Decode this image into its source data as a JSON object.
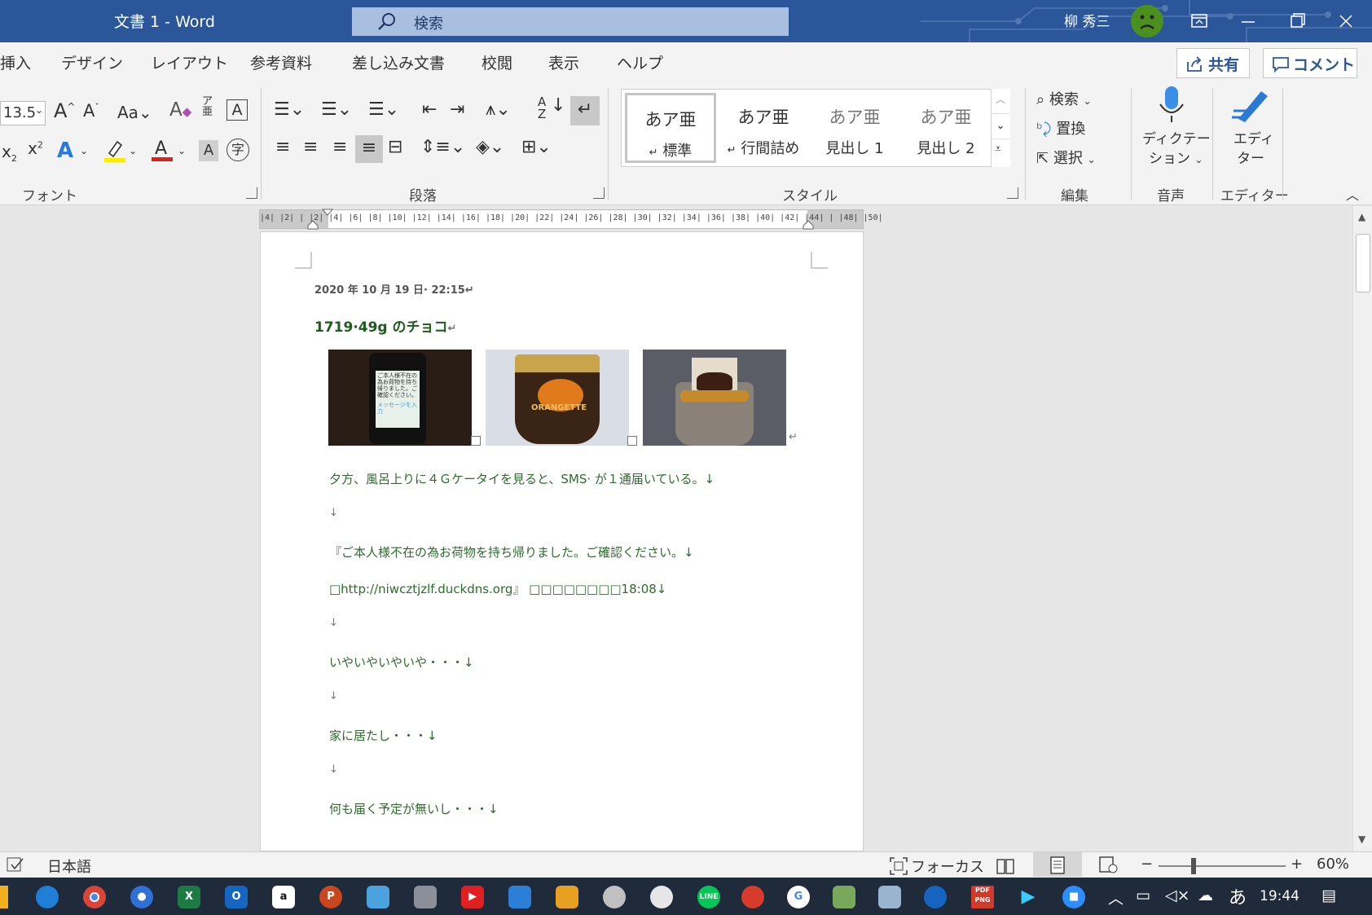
{
  "window": {
    "title": "文書 1  -  Word",
    "search_placeholder": "検索",
    "user": "柳 秀三"
  },
  "tabs": [
    "挿入",
    "デザイン",
    "レイアウト",
    "参考資料",
    "差し込み文書",
    "校閲",
    "表示",
    "ヘルプ"
  ],
  "share_label": "共有",
  "comment_label": "コメント",
  "ribbon": {
    "font_size": "13.5",
    "font_group": "フォント",
    "paragraph_group": "段落",
    "styles_group": "スタイル",
    "editing_group": "編集",
    "voice_group": "音声",
    "editor_group": "エディター",
    "styles": [
      {
        "sample": "あア亜",
        "name": "標準",
        "mark": "↵"
      },
      {
        "sample": "あア亜",
        "name": "行間詰め",
        "mark": "↵"
      },
      {
        "sample": "あア亜",
        "name": "見出し 1",
        "mark": ""
      },
      {
        "sample": "あア亜",
        "name": "見出し 2",
        "mark": ""
      }
    ],
    "find_label": "検索",
    "replace_label": "置換",
    "select_label": "選択",
    "dictate_label_1": "ディクテー",
    "dictate_label_2": "ション",
    "editor_label_1": "エディ",
    "editor_label_2": "ター"
  },
  "ruler_ticks": "|4|  |2|  |     |2|   |4|   |6|   |8|   |10|  |12|  |14|  |16|  |18|  |20|  |22|  |24|  |26|  |28|  |30|  |32|  |34|  |36|  |38|  |40|  |42|  |44|  |      |48|  |50|",
  "document": {
    "date": "2020 年 10 月 19 日· 22:15↵",
    "title": "1719·49g のチョコ",
    "title_mark": "↵",
    "lines": [
      "夕方、風呂上りに４Ｇケータイを見ると、SMS· が１通届いている。↓",
      "↓",
      "『ご本人様不在の為お荷物を持ち帰りました。ご確認ください。↓",
      "□http://niwcztjzlf.duckdns.org』 □□□□□□□□18:08↓",
      "↓",
      "いやいやいやいや・・・↓",
      "↓",
      "家に居たし・・・↓",
      "↓",
      "何も届く予定が無いし・・・↓"
    ],
    "photo_phone_text": "ご本人様不在の為お荷物を持ち帰りました。ご確認ください。",
    "photo_phone_input": "メッセージを入力",
    "photo_pack_text": "ORANGETTE"
  },
  "status": {
    "language": "日本語",
    "focus": "フォーカス",
    "zoom": "60%"
  },
  "taskbar": {
    "time": "19:44",
    "ime": "あ"
  },
  "colors": {
    "title_bar": "#2b579a",
    "doc_text": "#2e6b2e"
  }
}
